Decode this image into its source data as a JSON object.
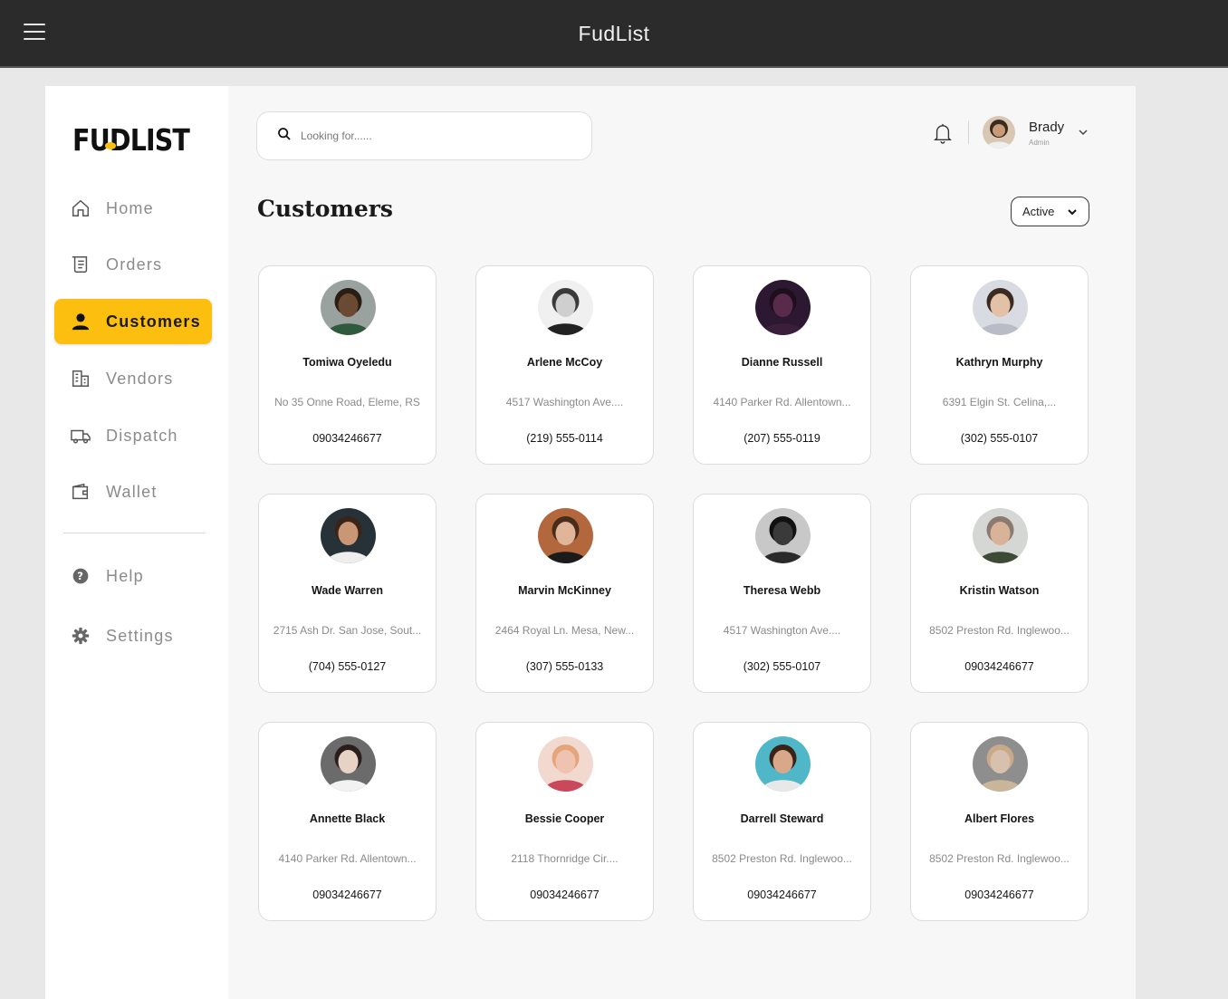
{
  "window": {
    "title": "FudList"
  },
  "brand": {
    "logo_text": "FUDLIST",
    "accent": "#fdbf0f"
  },
  "sidebar": {
    "items": [
      {
        "label": "Home",
        "icon": "home-icon"
      },
      {
        "label": "Orders",
        "icon": "receipt-icon"
      },
      {
        "label": "Customers",
        "icon": "person-icon",
        "active": true
      },
      {
        "label": "Vendors",
        "icon": "building-icon"
      },
      {
        "label": "Dispatch",
        "icon": "truck-icon"
      },
      {
        "label": "Wallet",
        "icon": "wallet-icon"
      }
    ],
    "bottom_items": [
      {
        "label": "Help",
        "icon": "help-icon"
      },
      {
        "label": "Settings",
        "icon": "gear-icon"
      }
    ]
  },
  "search": {
    "placeholder": "Looking for......"
  },
  "user": {
    "name": "Brady",
    "role": "Admin"
  },
  "page": {
    "title": "Customers"
  },
  "filter": {
    "selected": "Active"
  },
  "customers": [
    {
      "name": "Tomiwa Oyeledu",
      "address": "No 35 Onne Road, Eleme, RS",
      "phone": "09034246677",
      "skin": "#6b4a33",
      "hair": "#2a1d14",
      "bg": "#9aa2a0",
      "shirt": "#2f5a3b"
    },
    {
      "name": "Arlene McCoy",
      "address": "4517 Washington Ave....",
      "phone": "(219) 555-0114",
      "skin": "#cfcfcf",
      "hair": "#3a3a3a",
      "bg": "#f0f0f0",
      "shirt": "#222222"
    },
    {
      "name": "Dianne Russell",
      "address": "4140 Parker Rd. Allentown...",
      "phone": "(207) 555-0119",
      "skin": "#5a2a4a",
      "hair": "#1e0f1c",
      "bg": "#2c1830",
      "shirt": "#3b1e3a"
    },
    {
      "name": "Kathryn Murphy",
      "address": "6391 Elgin St. Celina,...",
      "phone": "(302) 555-0107",
      "skin": "#e2c1a6",
      "hair": "#3b2a20",
      "bg": "#d9dbe3",
      "shirt": "#b9bcc6"
    },
    {
      "name": "Wade Warren",
      "address": "2715 Ash Dr. San Jose, Sout...",
      "phone": "(704) 555-0127",
      "skin": "#c99676",
      "hair": "#3a2418",
      "bg": "#263238",
      "shirt": "#eeeeee"
    },
    {
      "name": "Marvin McKinney",
      "address": "2464 Royal Ln. Mesa, New...",
      "phone": "(307) 555-0133",
      "skin": "#e0b59a",
      "hair": "#4a2c1a",
      "bg": "#b3673d",
      "shirt": "#1b1b1b"
    },
    {
      "name": "Theresa Webb",
      "address": "4517 Washington Ave....",
      "phone": "(302) 555-0107",
      "skin": "#3a3a3a",
      "hair": "#111111",
      "bg": "#c8c8c8",
      "shirt": "#2a2a2a"
    },
    {
      "name": "Kristin Watson",
      "address": "8502 Preston Rd. Inglewoo...",
      "phone": "09034246677",
      "skin": "#d9b29a",
      "hair": "#8a7a70",
      "bg": "#d5d7d5",
      "shirt": "#3d4a35"
    },
    {
      "name": "Annette Black",
      "address": "4140 Parker Rd. Allentown...",
      "phone": "09034246677",
      "skin": "#e7d3c6",
      "hair": "#2a1f1c",
      "bg": "#6b6b6b",
      "shirt": "#f2f2f2"
    },
    {
      "name": "Bessie Cooper",
      "address": "2118 Thornridge Cir....",
      "phone": "09034246677",
      "skin": "#f0c3b0",
      "hair": "#e4a57d",
      "bg": "#f2d9cf",
      "shirt": "#c9485b"
    },
    {
      "name": "Darrell Steward",
      "address": "8502 Preston Rd. Inglewoo...",
      "phone": "09034246677",
      "skin": "#d9a88a",
      "hair": "#3a2418",
      "bg": "#4fb7c8",
      "shirt": "#e8e8e8"
    },
    {
      "name": "Albert Flores",
      "address": "8502 Preston Rd. Inglewoo...",
      "phone": "09034246677",
      "skin": "#d7c0ad",
      "hair": "#c8a98a",
      "bg": "#8e8e8e",
      "shirt": "#c9b59a"
    }
  ]
}
